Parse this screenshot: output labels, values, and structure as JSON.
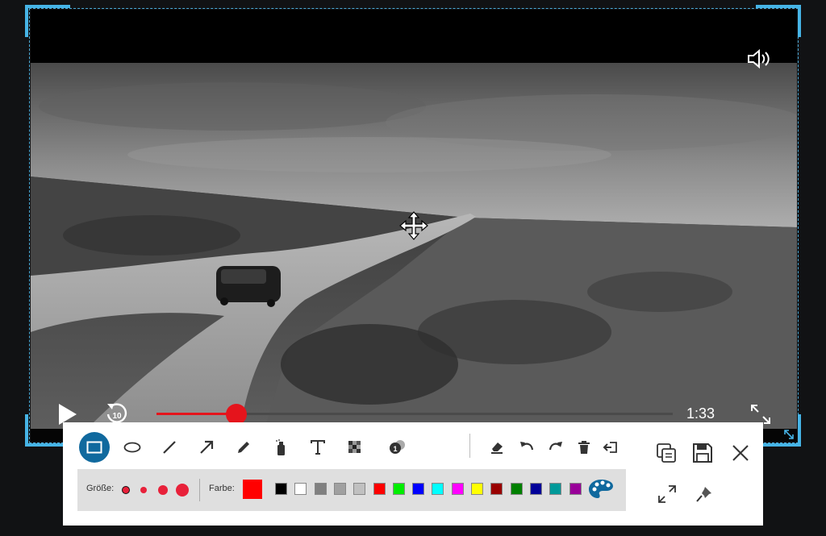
{
  "player": {
    "time": "1:33",
    "progress": 0.155,
    "replay_label": "10"
  },
  "toolbar": {
    "tools": [
      {
        "name": "rectangle-tool",
        "icon": "rectangle-icon",
        "active": true
      },
      {
        "name": "ellipse-tool",
        "icon": "ellipse-icon"
      },
      {
        "name": "line-tool",
        "icon": "line-icon"
      },
      {
        "name": "arrow-tool",
        "icon": "arrow-icon"
      },
      {
        "name": "pencil-tool",
        "icon": "pencil-icon"
      },
      {
        "name": "marker-tool",
        "icon": "highlighter-icon"
      },
      {
        "name": "text-tool",
        "icon": "text-icon"
      },
      {
        "name": "mosaic-tool",
        "icon": "mosaic-icon"
      },
      {
        "name": "step-number-tool",
        "icon": "step-number-icon"
      },
      {
        "name": "eraser-tool",
        "icon": "eraser-icon"
      },
      {
        "name": "undo-button",
        "icon": "undo-icon"
      },
      {
        "name": "redo-button",
        "icon": "redo-icon"
      },
      {
        "name": "delete-button",
        "icon": "trash-icon"
      },
      {
        "name": "exit-button",
        "icon": "exit-icon"
      }
    ],
    "size_label": "Größe:",
    "color_label": "Farbe:",
    "current_color": "#ff0000",
    "swatches": [
      "#000000",
      "#ffffff",
      "#808080",
      "#a0a0a0",
      "#c0c0c0",
      "#ff0000",
      "#00ee00",
      "#0000ff",
      "#00ffff",
      "#ff00ff",
      "#ffff00",
      "#990000",
      "#008000",
      "#000099",
      "#009999",
      "#990099"
    ],
    "side_buttons": {
      "copy": "copy-icon",
      "save": "save-icon",
      "close": "close-icon",
      "expand": "expand-icon",
      "pin": "pin-icon"
    },
    "accent_color": "#10699e"
  }
}
